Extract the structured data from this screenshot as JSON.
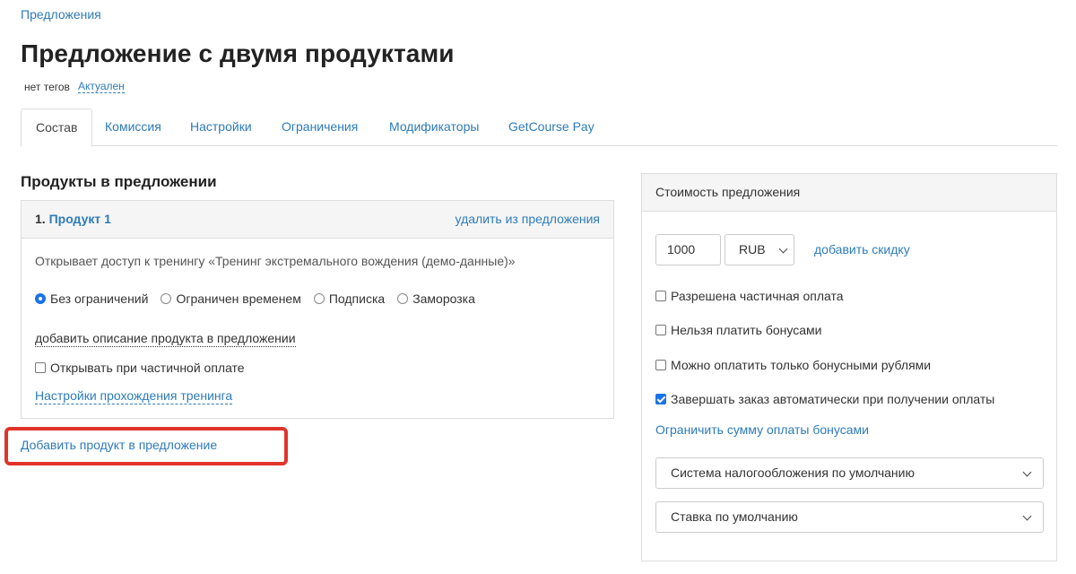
{
  "breadcrumb": "Предложения",
  "title": "Предложение с двумя продуктами",
  "meta": {
    "tags": "нет тегов",
    "status": "Актуален"
  },
  "tabs": [
    {
      "label": "Состав",
      "active": true
    },
    {
      "label": "Комиссия"
    },
    {
      "label": "Настройки"
    },
    {
      "label": "Ограничения"
    },
    {
      "label": "Модификаторы"
    },
    {
      "label": "GetCourse Pay"
    }
  ],
  "products_section": {
    "title": "Продукты в предложении",
    "product": {
      "number": "1.",
      "name": "Продукт 1",
      "remove_label": "удалить из предложения",
      "access_text": "Открывает доступ к тренингу «Тренинг экстремального вождения (демо-данные)»",
      "access_options": [
        {
          "label": "Без ограничений",
          "checked": true
        },
        {
          "label": "Ограничен временем",
          "checked": false
        },
        {
          "label": "Подписка",
          "checked": false
        },
        {
          "label": "Заморозка",
          "checked": false
        }
      ],
      "add_description_label": "добавить описание продукта в предложении",
      "open_on_partial_label": "Открывать при частичной оплате",
      "open_on_partial_checked": false,
      "training_settings_label": "Настройки прохождения тренинга"
    },
    "add_product_label": "Добавить продукт в предложение"
  },
  "price_panel": {
    "title": "Стоимость предложения",
    "price_value": "1000",
    "currency": "RUB",
    "add_discount_label": "добавить скидку",
    "options": [
      {
        "label": "Разрешена частичная оплата",
        "checked": false
      },
      {
        "label": "Нельзя платить бонусами",
        "checked": false
      },
      {
        "label": "Можно оплатить только бонусными рублями",
        "checked": false
      },
      {
        "label": "Завершать заказ автоматически при получении оплаты",
        "checked": true
      }
    ],
    "limit_bonus_label": "Ограничить сумму оплаты бонусами",
    "tax_system": "Система налогообложения по умолчанию",
    "tax_rate": "Ставка по умолчанию"
  },
  "colors": {
    "link": "#2e7bb8",
    "highlight": "#e0342b",
    "checkbox": "#1a73e8"
  }
}
